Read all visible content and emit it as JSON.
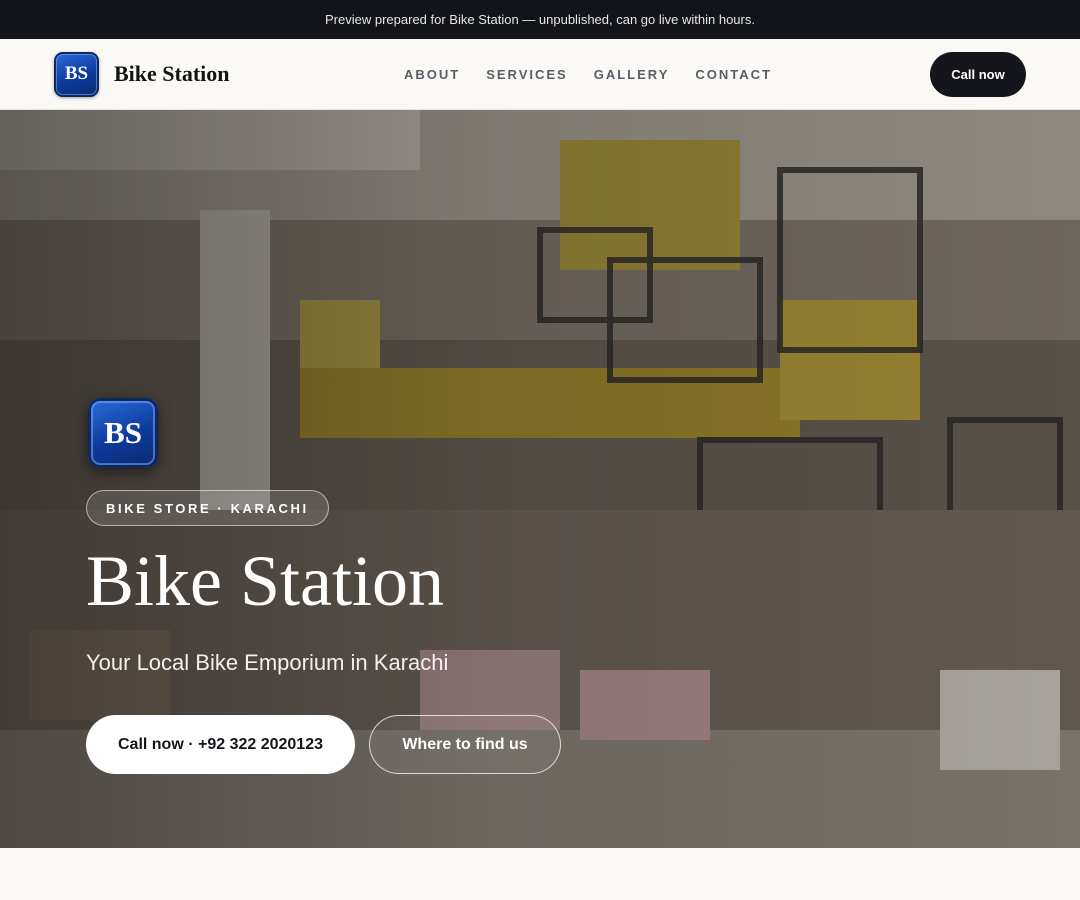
{
  "preview_bar": {
    "text": "Preview prepared for Bike Station — unpublished, can go live within hours."
  },
  "header": {
    "logo_initials": "BS",
    "brand_name": "Bike Station",
    "nav": [
      "ABOUT",
      "SERVICES",
      "GALLERY",
      "CONTACT"
    ],
    "call_label": "Call now"
  },
  "hero": {
    "logo_initials": "BS",
    "eyebrow": "BIKE STORE · KARACHI",
    "title": "Bike Station",
    "subtitle": "Your Local Bike Emporium in Karachi",
    "cta_primary": "Call now · +92 322 2020123",
    "cta_secondary": "Where to find us"
  },
  "colors": {
    "dark": "#12141a",
    "logo_blue": "#1a4fbf",
    "page_bg": "#faf9f6"
  }
}
